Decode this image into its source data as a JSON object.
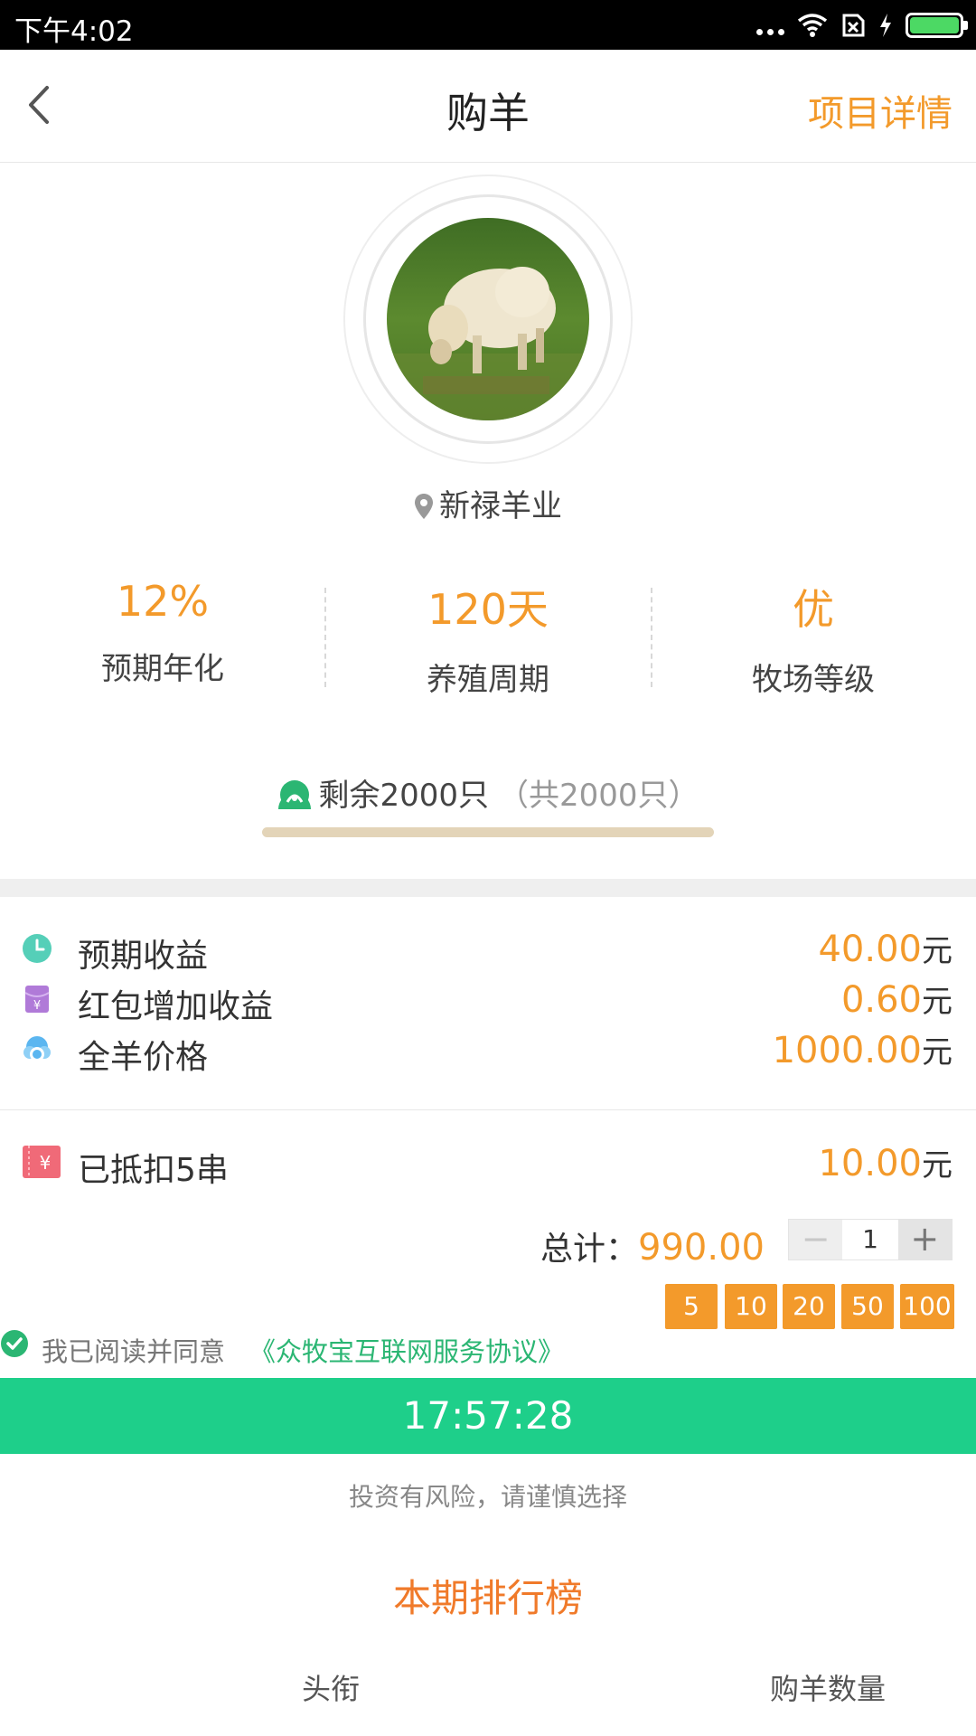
{
  "status_bar": {
    "time": "下午4:02"
  },
  "header": {
    "title": "购羊",
    "detail_link": "项目详情"
  },
  "project": {
    "location": "新禄羊业"
  },
  "stats": [
    {
      "value": "12%",
      "label": "预期年化"
    },
    {
      "value": "120天",
      "label": "养殖周期"
    },
    {
      "value": "优",
      "label": "牧场等级"
    }
  ],
  "remaining": {
    "text": "剩余2000只",
    "total": "（共2000只）",
    "sold_fraction": 0.0
  },
  "income": [
    {
      "label": "预期收益",
      "amount": "40.00",
      "unit": "元",
      "icon": "clock-icon",
      "color": "#55cfb8"
    },
    {
      "label": "红包增加收益",
      "amount": "0.60",
      "unit": "元",
      "icon": "red-envelope-icon",
      "color": "#b07ad8"
    },
    {
      "label": "全羊价格",
      "amount": "1000.00",
      "unit": "元",
      "icon": "sheep-price-icon",
      "color": "#5bb6f0"
    }
  ],
  "deduction": {
    "label": "已抵扣5串",
    "amount": "10.00",
    "unit": "元",
    "icon": "coupon-icon"
  },
  "total": {
    "label": "总计：",
    "value": "990.00"
  },
  "stepper": {
    "minus": "−",
    "quantity": "1",
    "plus": "+"
  },
  "quick_amounts": [
    "5",
    "10",
    "20",
    "50",
    "100"
  ],
  "agreement": {
    "prefix": "我已阅读并同意",
    "link": "《众牧宝互联网服务协议》"
  },
  "countdown": "17:57:28",
  "risk_notice": "投资有风险，请谨慎选择",
  "ranking": {
    "title": "本期排行榜",
    "col_title": "头衔",
    "col_count": "购羊数量"
  },
  "colors": {
    "accent": "#f39a2b",
    "green": "#1ecf8a",
    "link_green": "#2bb673"
  }
}
